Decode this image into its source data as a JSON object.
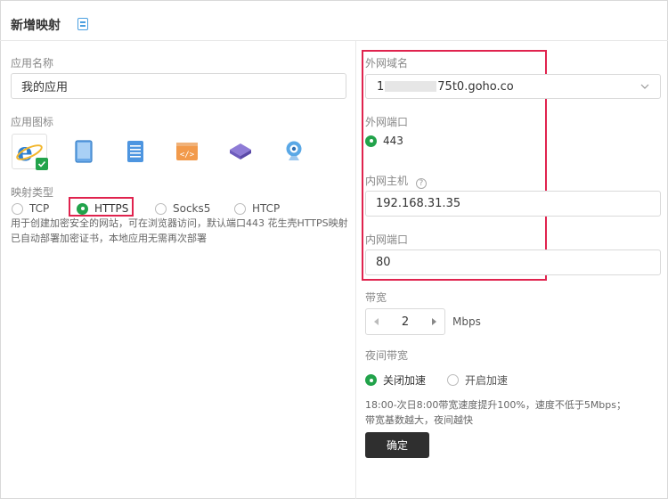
{
  "header": {
    "title": "新增映射",
    "doc_icon": "document-icon"
  },
  "app_name": {
    "label": "应用名称",
    "value": "我的应用"
  },
  "app_icon": {
    "label": "应用图标",
    "icons": [
      "ie-browser-icon",
      "tablet-icon",
      "document-list-icon",
      "code-icon",
      "cube-icon",
      "webcam-icon"
    ],
    "selected": 0
  },
  "mapping_type": {
    "label": "映射类型",
    "options": [
      "TCP",
      "HTTPS",
      "Socks5",
      "HTCP"
    ],
    "selected": "HTTPS",
    "description_line1": "用于创建加密安全的网站，可在浏览器访问，默认端口443 花生壳HTTPS映射",
    "description_line2": "已自动部署加密证书，本地应用无需再次部署"
  },
  "external_domain": {
    "label": "外网域名",
    "value_prefix": "1",
    "value_suffix": "75t0.goho.co"
  },
  "external_port": {
    "label": "外网端口",
    "value": "443"
  },
  "internal_host": {
    "label": "内网主机",
    "value": "192.168.31.35"
  },
  "internal_port": {
    "label": "内网端口",
    "value": "80"
  },
  "bandwidth": {
    "label": "带宽",
    "value": "2",
    "unit": "Mbps"
  },
  "night_bandwidth": {
    "label": "夜间带宽",
    "options": [
      "关闭加速",
      "开启加速"
    ],
    "selected": "关闭加速",
    "note_line1": "18:00-次日8:00带宽速度提升100%，速度不低于5Mbps；",
    "note_line2": "带宽基数越大，夜间越快"
  },
  "submit_label": "确定",
  "colors": {
    "accent_green": "#22a34b",
    "highlight_red": "#e0234e",
    "button_dark": "#2f2f2f",
    "icon_blue": "#4a9fe0"
  }
}
